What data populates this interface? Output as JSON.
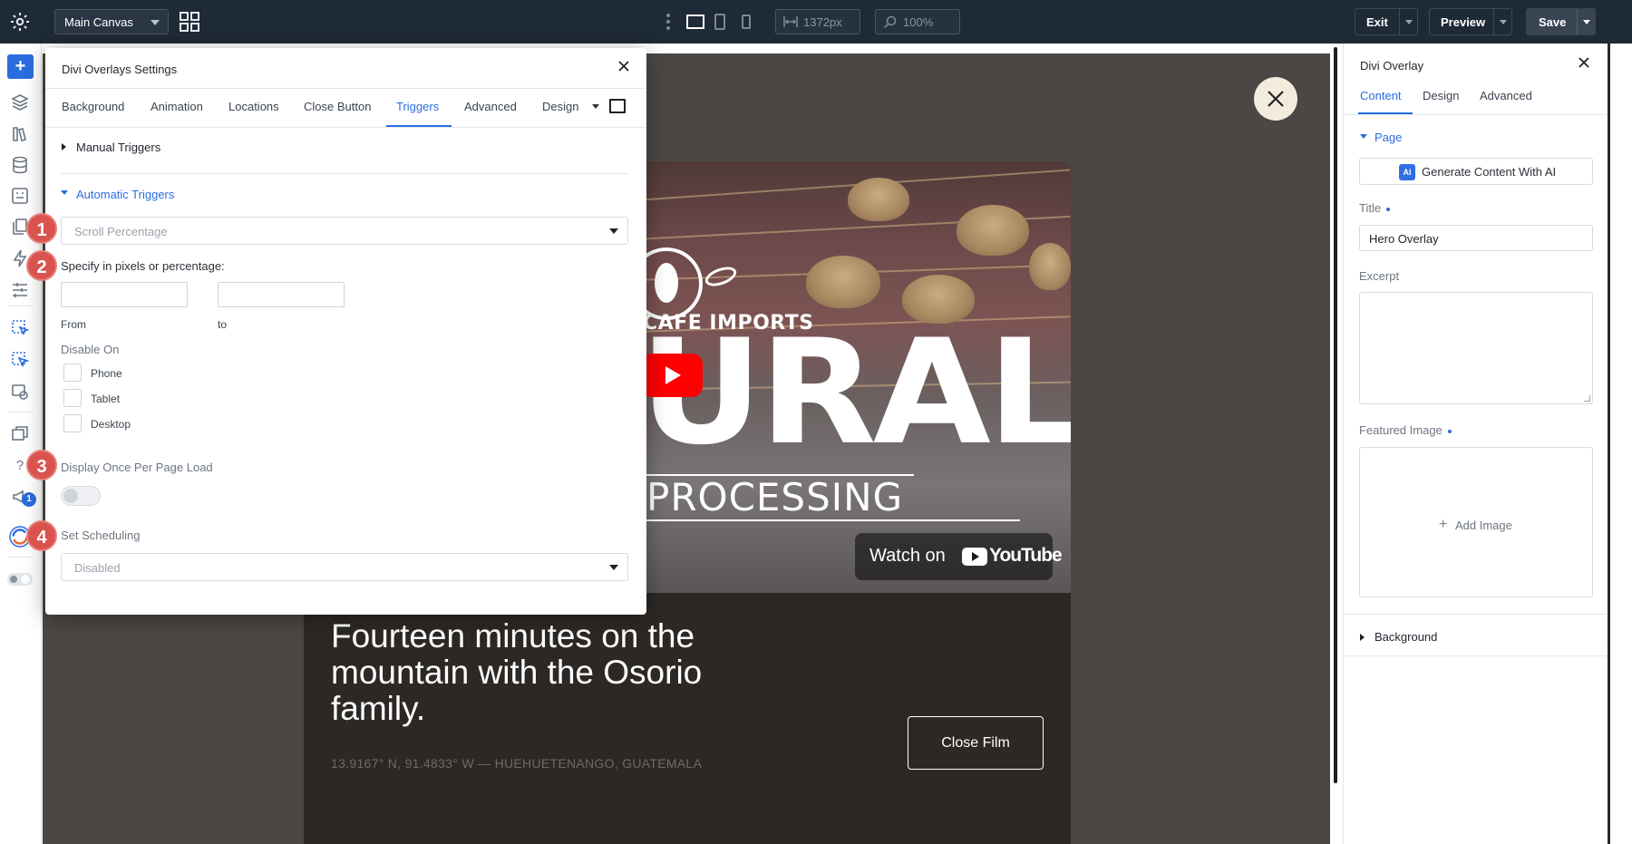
{
  "topbar": {
    "canvas_select": "Main Canvas",
    "width_field": "1372px",
    "zoom_field": "100%",
    "exit_label": "Exit",
    "preview_label": "Preview",
    "save_label": "Save"
  },
  "left_rail": {
    "notification_count": "1"
  },
  "modal": {
    "title": "Divi Overlays Settings",
    "tabs": [
      "Background",
      "Animation",
      "Locations",
      "Close Button",
      "Triggers",
      "Advanced",
      "Design"
    ],
    "active_tab": "Triggers",
    "manual_triggers_label": "Manual Triggers",
    "automatic_triggers_label": "Automatic Triggers",
    "trigger_type_value": "Scroll Percentage",
    "specify_label": "Specify in pixels or percentage:",
    "from_label": "From",
    "to_label": "to",
    "disable_on_label": "Disable On",
    "devices": [
      "Phone",
      "Tablet",
      "Desktop"
    ],
    "display_once_label": "Display Once Per Page Load",
    "scheduling_label": "Set Scheduling",
    "scheduling_value": "Disabled"
  },
  "steps": [
    "1",
    "2",
    "3",
    "4"
  ],
  "overlay_preview": {
    "brand_text": "CAFE IMPORTS",
    "big_word": "URAL",
    "sub_word": "PROCESSING",
    "watch_label": "Watch on",
    "youtube_word": "YouTube",
    "headline": "Fourteen minutes on the mountain with the Osorio family.",
    "coords": "13.9167° N, 91.4833° W — HUEHUETENANGO, GUATEMALA",
    "close_film_label": "Close Film"
  },
  "right_panel": {
    "title": "Divi Overlay",
    "tabs": [
      "Content",
      "Design",
      "Advanced"
    ],
    "active_tab": "Content",
    "page_section": "Page",
    "ai_button": "Generate Content With AI",
    "ai_badge": "AI",
    "title_label": "Title",
    "title_value": "Hero Overlay",
    "excerpt_label": "Excerpt",
    "featured_image_label": "Featured Image",
    "add_image_label": "Add Image",
    "background_section": "Background"
  },
  "colors": {
    "accent": "#2b6de0",
    "topbar": "#1f2a37",
    "step_badge": "#d9534f",
    "youtube_red": "#ff0000"
  }
}
